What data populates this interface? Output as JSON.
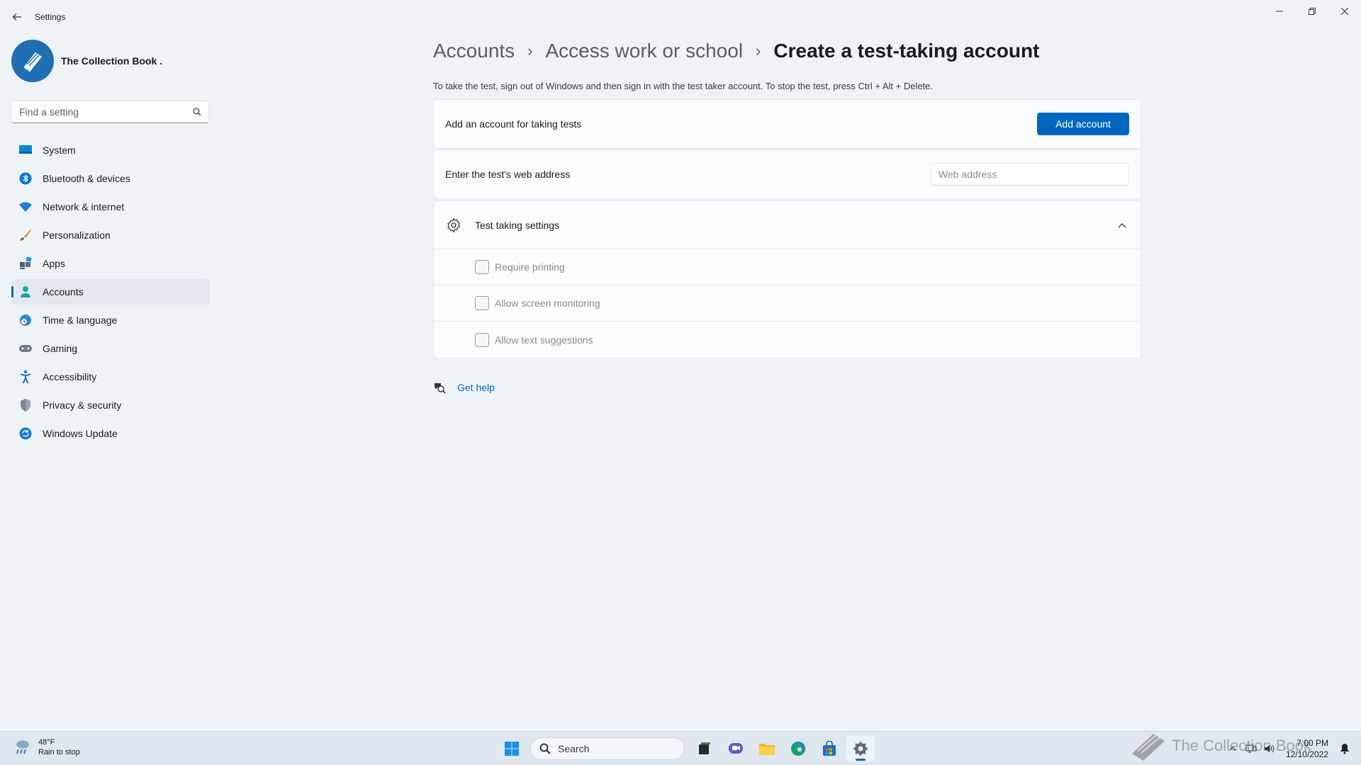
{
  "window": {
    "title": "Settings"
  },
  "profile": {
    "name": "The Collection Book ."
  },
  "search": {
    "placeholder": "Find a setting"
  },
  "sidebar": {
    "items": [
      {
        "label": "System",
        "icon": "monitor-icon",
        "active": false
      },
      {
        "label": "Bluetooth & devices",
        "icon": "bluetooth-icon",
        "active": false
      },
      {
        "label": "Network & internet",
        "icon": "wifi-icon",
        "active": false
      },
      {
        "label": "Personalization",
        "icon": "brush-icon",
        "active": false
      },
      {
        "label": "Apps",
        "icon": "apps-icon",
        "active": false
      },
      {
        "label": "Accounts",
        "icon": "person-icon",
        "active": true
      },
      {
        "label": "Time & language",
        "icon": "globe-clock-icon",
        "active": false
      },
      {
        "label": "Gaming",
        "icon": "gamepad-icon",
        "active": false
      },
      {
        "label": "Accessibility",
        "icon": "accessibility-icon",
        "active": false
      },
      {
        "label": "Privacy & security",
        "icon": "shield-icon",
        "active": false
      },
      {
        "label": "Windows Update",
        "icon": "update-icon",
        "active": false
      }
    ]
  },
  "breadcrumb": {
    "items": [
      "Accounts",
      "Access work or school"
    ],
    "current": "Create a test-taking account"
  },
  "main": {
    "description": "To take the test, sign out of Windows and then sign in with the test taker account. To stop the test, press Ctrl + Alt + Delete.",
    "add_account_row": {
      "label": "Add an account for taking tests",
      "button": "Add account"
    },
    "web_address_row": {
      "label": "Enter the test's web address",
      "placeholder": "Web address"
    },
    "test_settings": {
      "title": "Test taking settings",
      "options": [
        {
          "label": "Require printing",
          "checked": false
        },
        {
          "label": "Allow screen monitoring",
          "checked": false
        },
        {
          "label": "Allow text suggestions",
          "checked": false
        }
      ]
    },
    "help": {
      "label": "Get help"
    }
  },
  "taskbar": {
    "weather": {
      "temp": "48°F",
      "condition": "Rain to stop"
    },
    "search_label": "Search",
    "clock": {
      "time": "7:00 PM",
      "date": "12/10/2022"
    },
    "watermark": "The Collection Book"
  },
  "colors": {
    "accent": "#0067c0",
    "background": "#eef3f8"
  }
}
